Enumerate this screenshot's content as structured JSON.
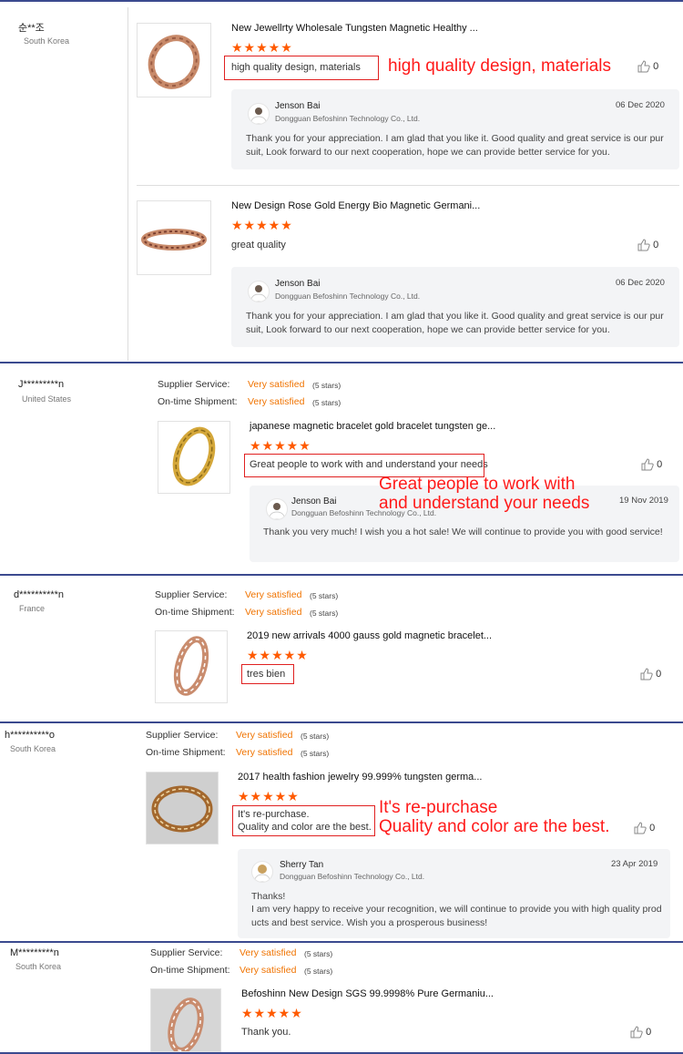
{
  "theme": {
    "accent": "#f07300",
    "star": "#ff5a00",
    "annotation": "#ff1a1a",
    "divider": "#3b4a8f"
  },
  "reviews": [
    {
      "user": "순**조",
      "country": "South Korea",
      "items": [
        {
          "title": "New Jewellrty Wholesale Tungsten Magnetic Healthy ...",
          "rating": 5,
          "text": "high quality design, materials",
          "annotation": "high quality design, materials",
          "likes": "0",
          "reply": {
            "name": "Jenson Bai",
            "company": "Dongguan Befoshinn Technology Co., Ltd.",
            "date": "06 Dec 2020",
            "text": "Thank you for your appreciation. I am glad that you like it. Good quality and great service is our pursuit, Look forward to our next cooperation, hope we can provide better service for you."
          }
        },
        {
          "title": "New Design Rose Gold Energy Bio Magnetic Germani...",
          "rating": 5,
          "text": "great quality",
          "likes": "0",
          "reply": {
            "name": "Jenson Bai",
            "company": "Dongguan Befoshinn Technology Co., Ltd.",
            "date": "06 Dec 2020",
            "text": "Thank you for your appreciation. I am glad that you like it. Good quality and great service is our pursuit, Look forward to our next cooperation, hope we can provide better service for you."
          }
        }
      ]
    },
    {
      "user": "J*********n",
      "country": "United States",
      "supplier_service_label": "Supplier Service:",
      "supplier_service": "Very satisfied",
      "supplier_stars": "(5 stars)",
      "shipment_label": "On-time Shipment:",
      "shipment": "Very satisfied",
      "shipment_stars": "(5 stars)",
      "title": "japanese magnetic bracelet gold bracelet tungsten ge...",
      "rating": 5,
      "text": "Great people to work with and understand your needs",
      "annotation_line1": "Great people to work with",
      "annotation_line2": "and understand your needs",
      "likes": "0",
      "reply": {
        "name": "Jenson Bai",
        "company": "Dongguan Befoshinn Technology Co., Ltd.",
        "date": "19 Nov 2019",
        "text": "Thank you very much! I wish you a hot sale!  We will continue to provide you with good service!"
      }
    },
    {
      "user": "d**********n",
      "country": "France",
      "supplier_service_label": "Supplier Service:",
      "supplier_service": "Very satisfied",
      "supplier_stars": "(5 stars)",
      "shipment_label": "On-time Shipment:",
      "shipment": "Very satisfied",
      "shipment_stars": "(5 stars)",
      "title": "2019 new arrivals 4000 gauss gold magnetic bracelet...",
      "rating": 5,
      "text": "tres bien",
      "likes": "0"
    },
    {
      "user": "h**********o",
      "country": "South Korea",
      "supplier_service_label": "Supplier Service:",
      "supplier_service": "Very satisfied",
      "supplier_stars": "(5 stars)",
      "shipment_label": "On-time Shipment:",
      "shipment": "Very satisfied",
      "shipment_stars": "(5 stars)",
      "title": "2017 health fashion jewelry 99.999% tungsten germa...",
      "rating": 5,
      "text_line1": "It's re-purchase.",
      "text_line2": "Quality and color are the best.",
      "annotation_line1": "It's re-purchase",
      "annotation_line2": "Quality and color are the best.",
      "likes": "0",
      "reply": {
        "name": "Sherry Tan",
        "company": "Dongguan Befoshinn Technology Co., Ltd.",
        "date": "23 Apr 2019",
        "text_line1": "Thanks!",
        "text": "I am very happy to receive your recognition, we will continue to provide you with high quality products and best service. Wish you a prosperous business!"
      }
    },
    {
      "user": "M*********n",
      "country": "South Korea",
      "supplier_service_label": "Supplier Service:",
      "supplier_service": "Very satisfied",
      "supplier_stars": "(5 stars)",
      "shipment_label": "On-time Shipment:",
      "shipment": "Very satisfied",
      "shipment_stars": "(5 stars)",
      "title": "Befoshinn New Design SGS 99.9998% Pure Germaniu...",
      "rating": 5,
      "text": "Thank you.",
      "likes": "0"
    }
  ]
}
